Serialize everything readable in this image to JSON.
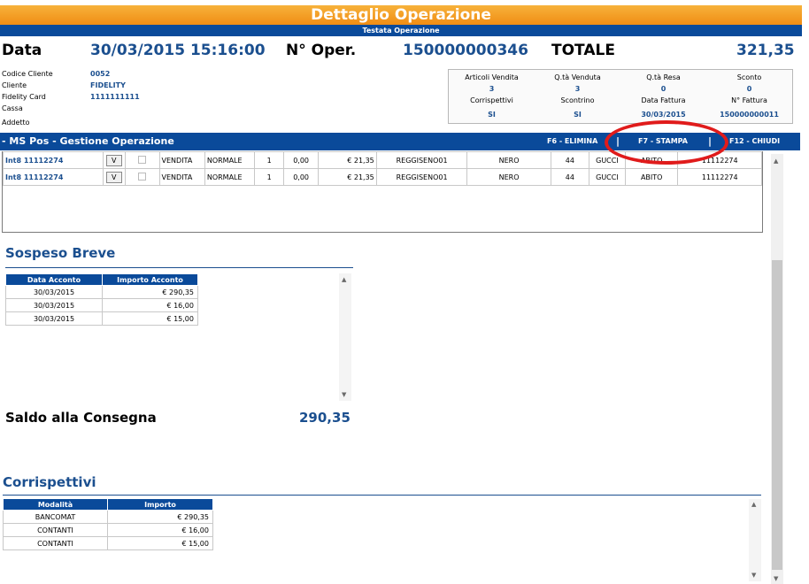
{
  "window": {
    "title": "Dettaglio Operazione",
    "subtitle": "Testata Operazione"
  },
  "header": {
    "data_label": "Data",
    "data_value": "30/03/2015 15:16:00",
    "oper_label": "N° Oper.",
    "oper_value": "150000000346",
    "totale_label": "TOTALE",
    "totale_value": "321,35"
  },
  "client": {
    "codice_label": "Codice Cliente",
    "codice_value": "0052",
    "cliente_label": "Cliente",
    "cliente_value": "FIDELITY",
    "fidelity_label": "Fidelity Card",
    "fidelity_value": "1111111111",
    "cassa_label": "Cassa",
    "addetto_label": "Addetto"
  },
  "stats": {
    "row1_labels": [
      "Articoli Vendita",
      "Q.tà Venduta",
      "Q.tà Resa",
      "Sconto"
    ],
    "row1_values": [
      "3",
      "3",
      "0",
      "0"
    ],
    "row2_labels": [
      "Corrispettivi",
      "Scontrino",
      "Data Fattura",
      "N° Fattura"
    ],
    "row2_values": [
      "SI",
      "SI",
      "30/03/2015",
      "150000000011"
    ]
  },
  "ms_bar": {
    "title": "- MS Pos - Gestione Operazione",
    "f6": "F6 - ELIMINA",
    "f7": "F7 - STAMPA",
    "f12": "F12 - CHIUDI",
    "separator": "|"
  },
  "lines": [
    {
      "code": "Int8 11112274",
      "btn": "V",
      "tipo": "VENDITA",
      "stato": "NORMALE",
      "qty": "1",
      "sconto": "0,00",
      "prezzo": "€ 21,35",
      "articolo": "REGGISENO01",
      "colore": "NERO",
      "taglia": "44",
      "marca": "GUCCI",
      "categoria": "ABITO",
      "barcode": "11112274"
    },
    {
      "code": "Int8 11112274",
      "btn": "V",
      "tipo": "VENDITA",
      "stato": "NORMALE",
      "qty": "1",
      "sconto": "0,00",
      "prezzo": "€ 21,35",
      "articolo": "REGGISENO01",
      "colore": "NERO",
      "taglia": "44",
      "marca": "GUCCI",
      "categoria": "ABITO",
      "barcode": "11112274"
    }
  ],
  "sospeso": {
    "title": "Sospeso Breve",
    "headers": [
      "Data Acconto",
      "Importo Acconto"
    ],
    "rows": [
      [
        "30/03/2015",
        "€ 290,35"
      ],
      [
        "30/03/2015",
        "€ 16,00"
      ],
      [
        "30/03/2015",
        "€ 15,00"
      ]
    ]
  },
  "saldo": {
    "label": "Saldo alla Consegna",
    "value": "290,35"
  },
  "corrispettivi": {
    "title": "Corrispettivi",
    "headers": [
      "Modalità",
      "Importo"
    ],
    "rows": [
      [
        "BANCOMAT",
        "€ 290,35"
      ],
      [
        "CONTANTI",
        "€ 16,00"
      ],
      [
        "CONTANTI",
        "€ 15,00"
      ]
    ]
  },
  "icons": {
    "scroll_up": "▲",
    "scroll_down": "▼"
  },
  "colors": {
    "accent_orange": "#f08d14",
    "navy": "#0a4a9a",
    "value_blue": "#1b4f8f",
    "highlight_red": "#e01b1b"
  }
}
